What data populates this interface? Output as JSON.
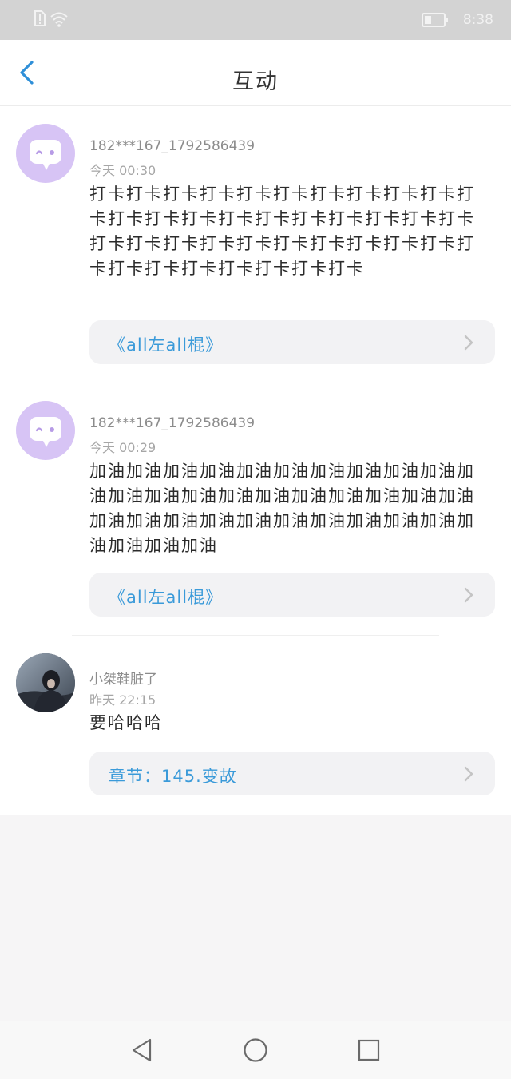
{
  "status_bar": {
    "time": "8:38",
    "icons": [
      "sim-alert-icon",
      "wifi-icon",
      "battery-icon"
    ]
  },
  "header": {
    "title": "互动",
    "back_icon": "chevron-left-icon"
  },
  "feed": [
    {
      "username": "182***167_1792586439",
      "time": "今天 00:30",
      "content": "打卡打卡打卡打卡打卡打卡打卡打卡打卡打卡打卡打卡打卡打卡打卡打卡打卡打卡打卡打卡打卡打卡打卡打卡打卡打卡打卡打卡打卡打卡打卡打卡打卡打卡打卡打卡打卡打卡打卡",
      "ref": "《all左all棍》",
      "avatar": "default-chat-bubble-avatar"
    },
    {
      "username": "182***167_1792586439",
      "time": "今天 00:29",
      "content": "加油加油加油加油加油加油加油加油加油加油加油加油加油加油加油加油加油加油加油加油加油加油加油加油加油加油加油加油加油加油加油加油加油加油加油",
      "ref": "《all左all棍》",
      "avatar": "default-chat-bubble-avatar"
    },
    {
      "username": "小桀鞋脏了",
      "time": "昨天 22:15",
      "content": "要哈哈哈",
      "ref": "章节：145.变故",
      "avatar": "photo-avatar"
    }
  ],
  "nav": {
    "back": "triangle-back-icon",
    "home": "circle-home-icon",
    "recent": "square-recent-icon"
  },
  "colors": {
    "accent": "#3a9ad9",
    "avatar_bg": "#d7c4f5",
    "card_bg": "#f2f2f4",
    "status_bar_bg": "#d3d3d3"
  }
}
